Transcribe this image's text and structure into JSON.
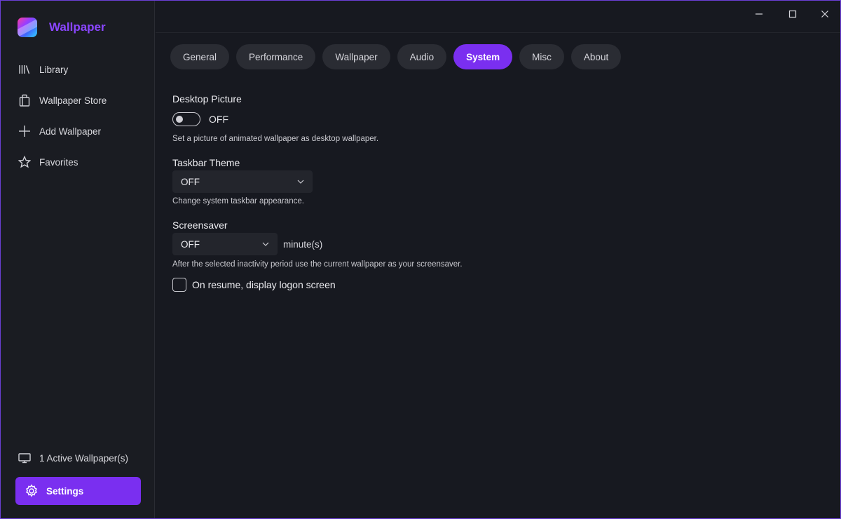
{
  "app": {
    "name": "Wallpaper",
    "brand_color": "#8a46ff",
    "accent": "#7a2ff0"
  },
  "sidebar": {
    "items": [
      {
        "label": "Library",
        "icon": "library-icon"
      },
      {
        "label": "Wallpaper Store",
        "icon": "store-bag-icon"
      },
      {
        "label": "Add Wallpaper",
        "icon": "plus-icon"
      },
      {
        "label": "Favorites",
        "icon": "star-icon"
      }
    ],
    "active_wallpapers": "1 Active Wallpaper(s)",
    "settings_label": "Settings"
  },
  "tabs": [
    {
      "label": "General",
      "active": false
    },
    {
      "label": "Performance",
      "active": false
    },
    {
      "label": "Wallpaper",
      "active": false
    },
    {
      "label": "Audio",
      "active": false
    },
    {
      "label": "System",
      "active": true
    },
    {
      "label": "Misc",
      "active": false
    },
    {
      "label": "About",
      "active": false
    }
  ],
  "system": {
    "desktop_picture": {
      "label": "Desktop Picture",
      "toggle_state": "OFF",
      "help": "Set a picture of animated wallpaper as desktop wallpaper."
    },
    "taskbar_theme": {
      "label": "Taskbar Theme",
      "value": "OFF",
      "help": "Change system taskbar appearance."
    },
    "screensaver": {
      "label": "Screensaver",
      "value": "OFF",
      "unit": "minute(s)",
      "help": "After the selected inactivity period use the current wallpaper as your screensaver."
    },
    "logon_checkbox": {
      "label": "On resume, display logon screen",
      "checked": false
    }
  }
}
